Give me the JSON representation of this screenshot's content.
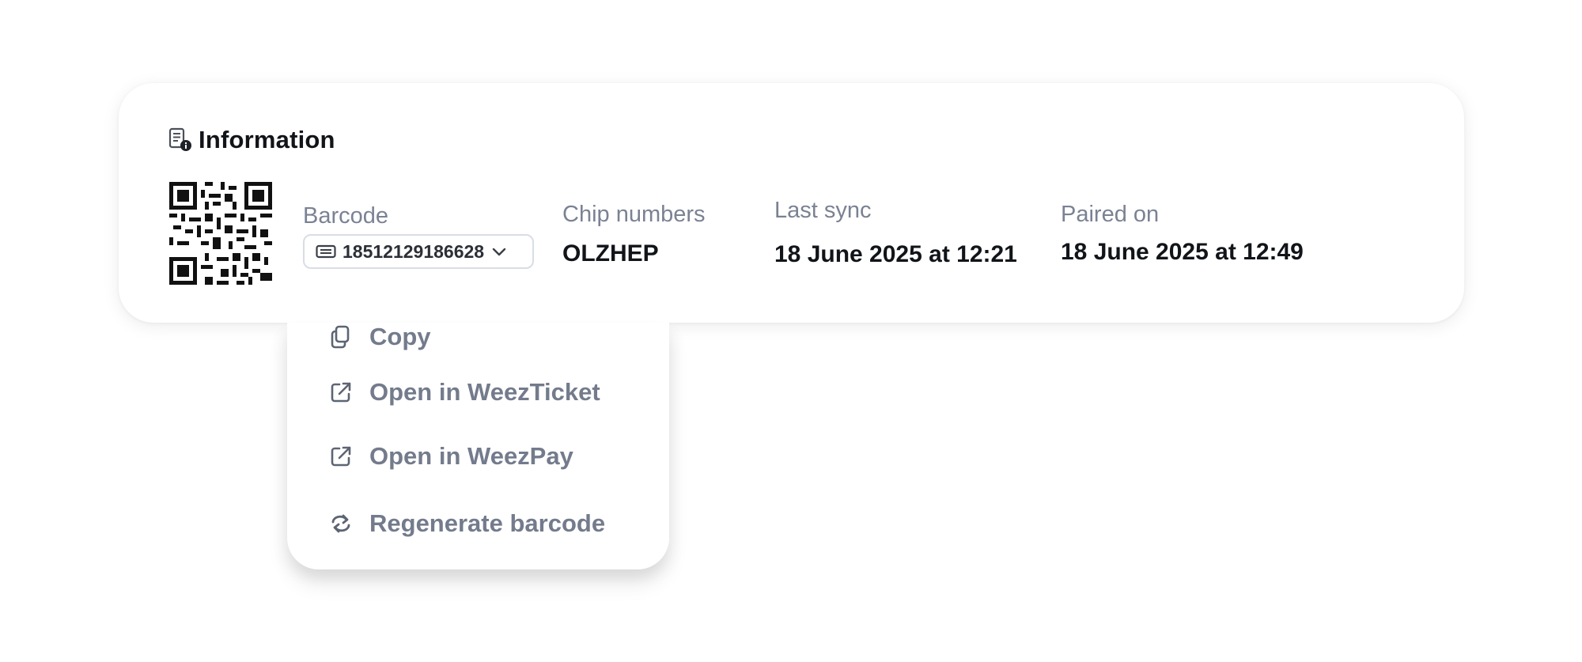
{
  "card": {
    "title": "Information",
    "title_icon": "document-info-icon",
    "qr_icon": "qr-code-icon"
  },
  "fields": {
    "barcode": {
      "label": "Barcode",
      "value": "18512129186628",
      "icon": "ticket-icon",
      "chevron": "chevron-down-icon"
    },
    "chip_numbers": {
      "label": "Chip numbers",
      "value": "OLZHEP"
    },
    "last_sync": {
      "label": "Last sync",
      "value": "18 June 2025 at 12:21"
    },
    "paired_on": {
      "label": "Paired on",
      "value": "18 June 2025 at 12:49"
    }
  },
  "menu": {
    "items": [
      {
        "label": "Copy",
        "icon": "copy-icon"
      },
      {
        "label": "Open in WeezTicket",
        "icon": "external-link-icon"
      },
      {
        "label": "Open in WeezPay",
        "icon": "external-link-icon"
      },
      {
        "label": "Regenerate barcode",
        "icon": "refresh-icon"
      }
    ]
  },
  "colors": {
    "text_primary": "#111418",
    "text_muted": "#7a8293",
    "menu_text": "#737b8c",
    "border": "#d9dde4",
    "background": "#ffffff"
  }
}
